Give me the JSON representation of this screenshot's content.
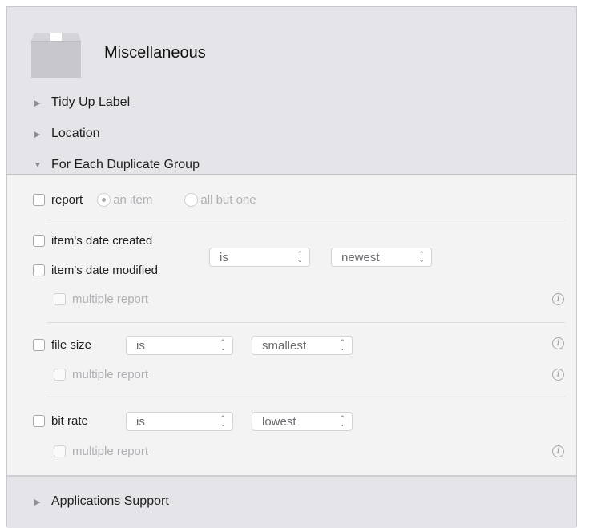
{
  "title": "Miscellaneous",
  "sections": [
    {
      "label": "Tidy Up Label",
      "expanded": false
    },
    {
      "label": "Location",
      "expanded": false
    },
    {
      "label": "For Each Duplicate Group",
      "expanded": true
    }
  ],
  "footer_section": {
    "label": "Applications Support",
    "expanded": false
  },
  "group": {
    "report": {
      "label": "report",
      "checked": false,
      "options": [
        "an item",
        "all but one"
      ],
      "selected": "an item"
    },
    "dates": {
      "created_label": "item's date created",
      "modified_label": "item's date modified",
      "operator": "is",
      "value": "newest",
      "multiple_label": "multiple report"
    },
    "file_size": {
      "label": "file size",
      "operator": "is",
      "value": "smallest",
      "multiple_label": "multiple report"
    },
    "bit_rate": {
      "label": "bit rate",
      "operator": "is",
      "value": "lowest",
      "multiple_label": "multiple report"
    }
  },
  "icons": {
    "disclosure_closed": "▶",
    "disclosure_open": "▼",
    "info": "i",
    "popup_arrows": "⌃⌄"
  }
}
